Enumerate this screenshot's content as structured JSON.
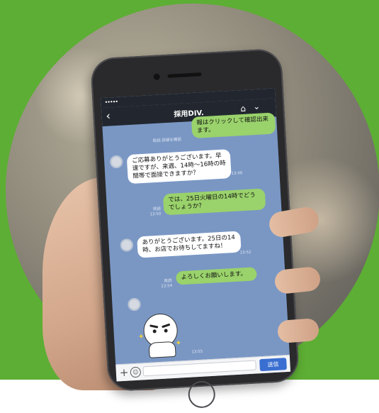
{
  "header": {
    "signal": "•••••",
    "title": "採用DIV.",
    "back_icon": "chevron-left-icon",
    "home_icon": "home-icon",
    "menu_icon": "chevron-down-icon"
  },
  "messages": [
    {
      "side": "out",
      "text": "報はクリックして確認出来ます。",
      "meta": ""
    },
    {
      "side": "meta",
      "text": "",
      "meta": "既読 詳細を確認"
    },
    {
      "side": "in",
      "text": "ご応募ありがとうございます。早速ですが、来週、14時〜16時の時間帯で面接できますか？",
      "meta": "13:46"
    },
    {
      "side": "out",
      "text": "では、25日火曜日の14時でどうでしょうか？",
      "meta": "既読 13:50"
    },
    {
      "side": "in",
      "text": "ありがとうございます。25日の14時、お店でお待ちしてますね！",
      "meta": "13:52"
    },
    {
      "side": "out",
      "text": "よろしくお願いします。",
      "meta": "既読 13:54"
    },
    {
      "side": "sticker",
      "text": "",
      "meta": "13:55"
    }
  ],
  "input": {
    "placeholder": "",
    "send_label": "送信",
    "plus_icon": "plus-icon",
    "emoji_icon": "emoji-icon"
  },
  "colors": {
    "background": "#5dae34",
    "chat_bg": "#7a97c4",
    "outgoing_bubble": "#9ad26b",
    "incoming_bubble": "#ffffff",
    "header": "#22272f",
    "send_button": "#3a6fd1"
  }
}
